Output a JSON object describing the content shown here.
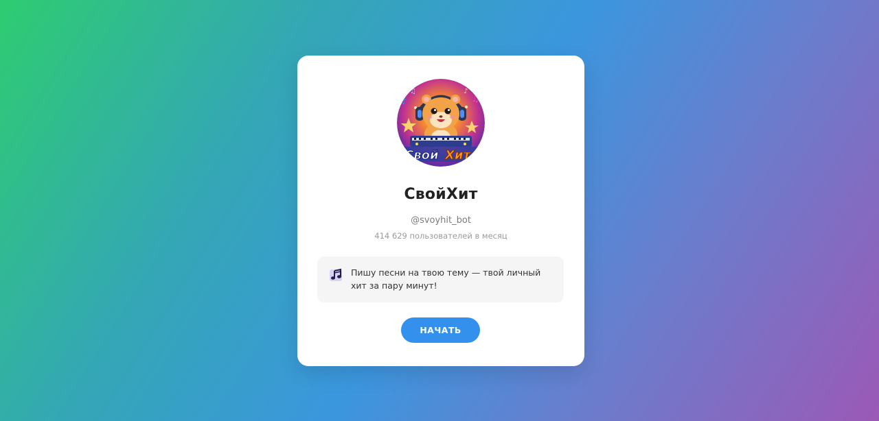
{
  "bot": {
    "name": "СвойХит",
    "username": "@svoyhit_bot",
    "monthly_users": "414 629 пользователей в месяц",
    "description": "Пишу песни на твою тему — твой личный хит за пару минут!",
    "avatar_logo_text_a": "Свой",
    "avatar_logo_text_b": "Хит",
    "start_button_label": "НАЧАТЬ"
  },
  "icons": {
    "avatar": "hamster-dj-avatar-icon",
    "description": "musical-notes-icon"
  },
  "colors": {
    "button": "#3390ec",
    "card_background": "#ffffff",
    "description_background": "#f5f5f5",
    "gradient_start": "#2ecc71",
    "gradient_mid": "#3b96de",
    "gradient_end": "#9b59b6"
  }
}
